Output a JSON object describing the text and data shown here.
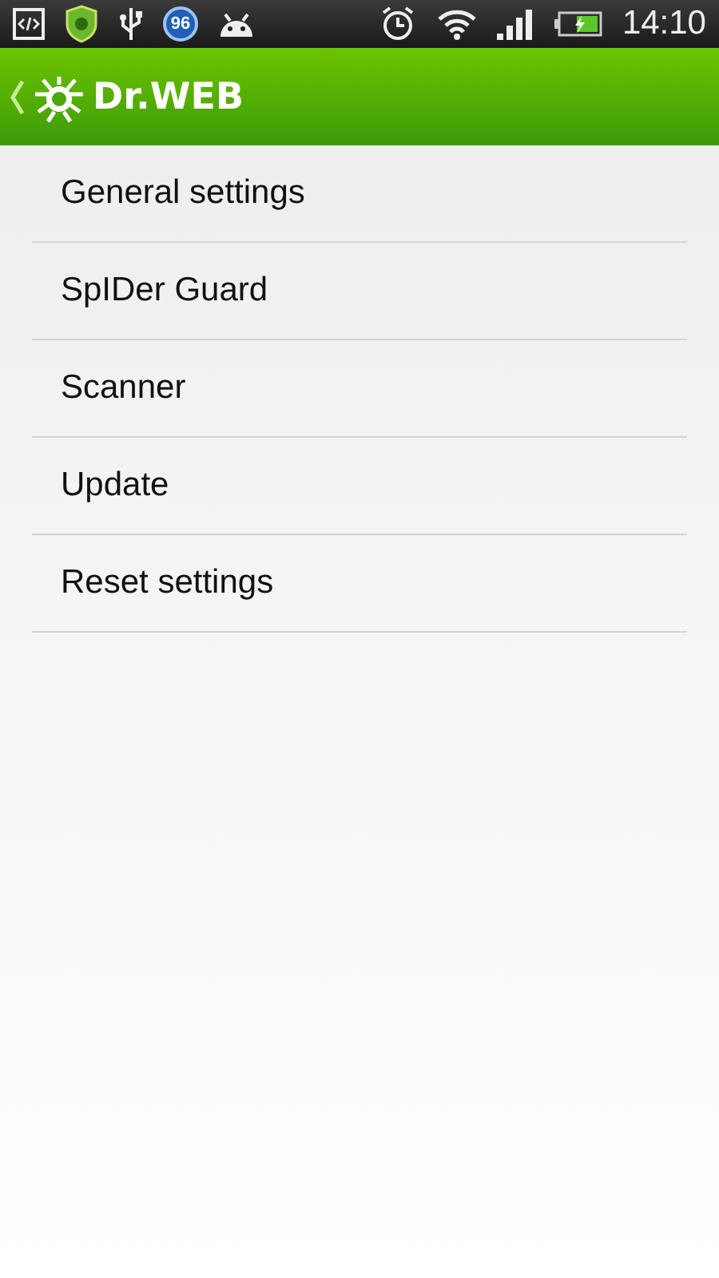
{
  "status_bar": {
    "notification_badge": "96",
    "time": "14:10"
  },
  "app_bar": {
    "title": "Dr.WEB"
  },
  "settings": [
    {
      "label": "General settings"
    },
    {
      "label": "SpIDer Guard"
    },
    {
      "label": "Scanner"
    },
    {
      "label": "Update"
    },
    {
      "label": "Reset settings"
    }
  ]
}
